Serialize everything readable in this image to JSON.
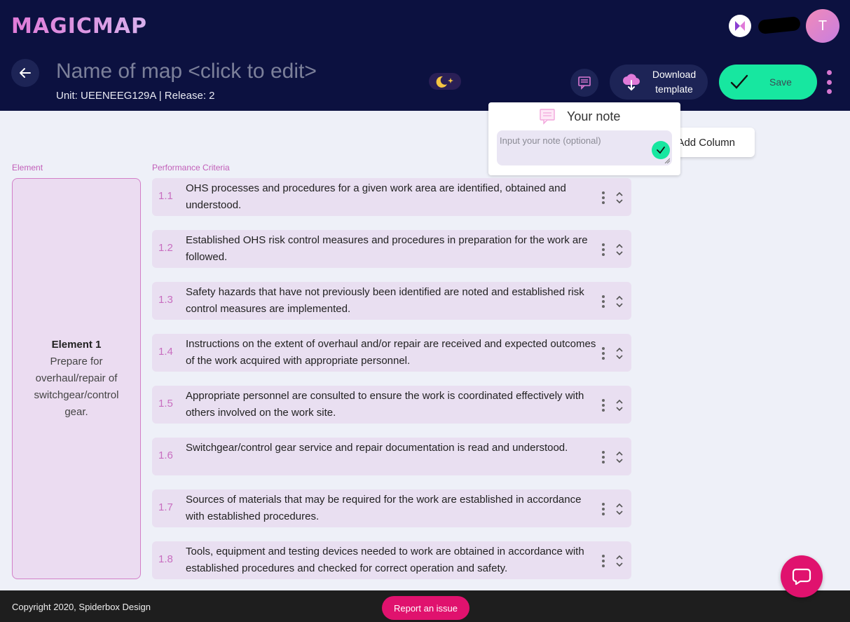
{
  "app": {
    "logo_text": "MAGICMAP",
    "avatar_initial": "T"
  },
  "map": {
    "title_placeholder": "Name of map <click to edit>",
    "unit_line": "Unit: UEENEEG129A | Release: 2"
  },
  "toolbar": {
    "download_label": "Download template",
    "save_label": "Save"
  },
  "note": {
    "title": "Your note",
    "placeholder": "Input your note (optional)"
  },
  "add_column_label": "Add Column",
  "columns": {
    "element_label": "Element",
    "criteria_label": "Performance Criteria"
  },
  "element": {
    "title": "Element 1",
    "description": "Prepare for overhaul/repair of switchgear/control gear."
  },
  "criteria": [
    {
      "num": "1.1",
      "text": "OHS processes and procedures for a given work area are identified, obtained and understood."
    },
    {
      "num": "1.2",
      "text": "Established OHS risk control measures and procedures in preparation for the work are followed."
    },
    {
      "num": "1.3",
      "text": "Safety hazards that have not previously been identified are noted and established risk control measures are implemented."
    },
    {
      "num": "1.4",
      "text": "Instructions on the extent of overhaul and/or repair are received and expected outcomes of the work acquired with appropriate personnel."
    },
    {
      "num": "1.5",
      "text": "Appropriate personnel are consulted to ensure the work is coordinated effectively with others involved on the work site."
    },
    {
      "num": "1.6",
      "text": "Switchgear/control gear service and repair documentation is read and understood."
    },
    {
      "num": "1.7",
      "text": "Sources of materials that may be required for the work are established in accordance with established procedures."
    },
    {
      "num": "1.8",
      "text": "Tools, equipment and testing devices needed to work are obtained in accordance with established procedures and checked for correct operation and safety."
    }
  ],
  "footer": {
    "copyright": "Copyright 2020, Spiderbox Design",
    "report_label": "Report an issue"
  },
  "colors": {
    "header_bg": "#0c1140",
    "accent_pink": "#e0126e",
    "save_green": "#17e7a0",
    "card_lilac": "#e9dff1"
  }
}
